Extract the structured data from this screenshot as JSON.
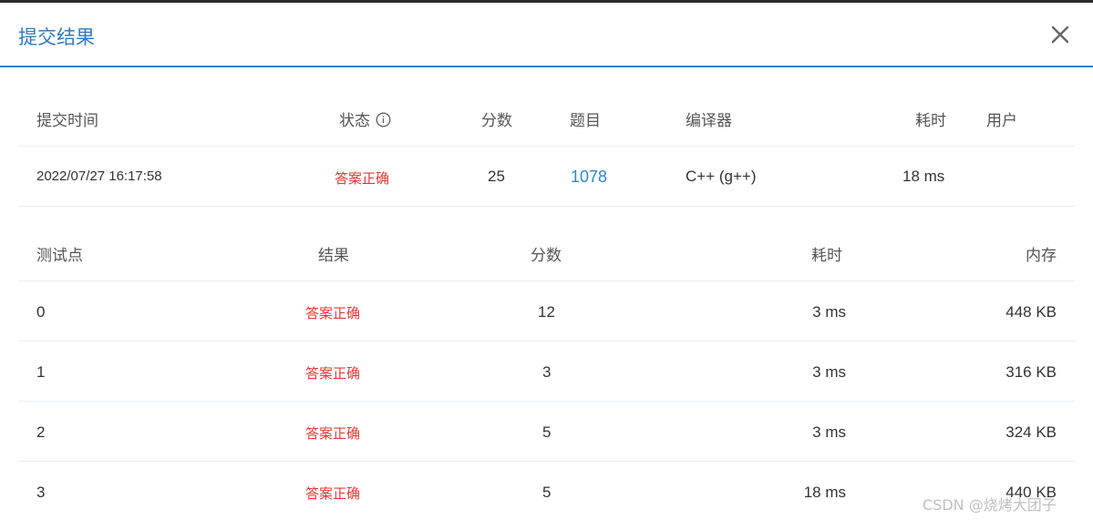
{
  "dialog": {
    "title": "提交结果"
  },
  "submission": {
    "headers": {
      "time": "提交时间",
      "status": "状态",
      "score": "分数",
      "problem": "题目",
      "compiler": "编译器",
      "elapsed": "耗时",
      "user": "用户"
    },
    "row": {
      "time": "2022/07/27 16:17:58",
      "status": "答案正确",
      "score": "25",
      "problem": "1078",
      "compiler": "C++ (g++)",
      "elapsed": "18 ms",
      "user": ""
    }
  },
  "testcases": {
    "headers": {
      "case": "测试点",
      "result": "结果",
      "score": "分数",
      "elapsed": "耗时",
      "memory": "内存"
    },
    "rows": [
      {
        "case": "0",
        "result": "答案正确",
        "score": "12",
        "elapsed": "3 ms",
        "memory": "448 KB"
      },
      {
        "case": "1",
        "result": "答案正确",
        "score": "3",
        "elapsed": "3 ms",
        "memory": "316 KB"
      },
      {
        "case": "2",
        "result": "答案正确",
        "score": "5",
        "elapsed": "3 ms",
        "memory": "324 KB"
      },
      {
        "case": "3",
        "result": "答案正确",
        "score": "5",
        "elapsed": "18 ms",
        "memory": "440 KB"
      }
    ]
  },
  "watermark": "CSDN @烧烤大团子",
  "colors": {
    "accent": "#2f7bc4",
    "success_text": "#e53935",
    "link": "#2f86d0"
  },
  "icons": {
    "close": "close-icon",
    "status_info": "info-icon"
  }
}
